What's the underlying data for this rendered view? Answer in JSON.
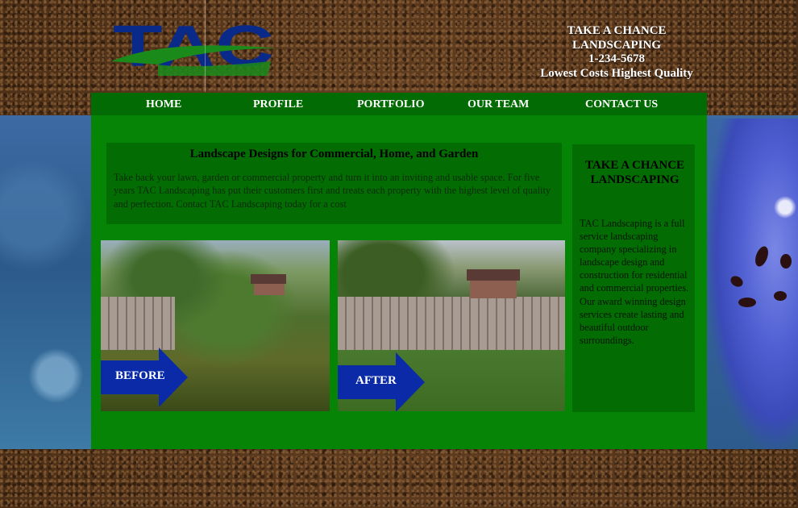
{
  "header": {
    "logo_text": "TAC",
    "company_name": "TAKE A CHANCE LANDSCAPING",
    "phone": "1-234-5678",
    "tagline": "Lowest Costs Highest Quality"
  },
  "nav": {
    "items": [
      "HOME",
      "PROFILE",
      "PORTFOLIO",
      "OUR TEAM",
      "CONTACT US"
    ]
  },
  "intro": {
    "title": "Landscape Designs for Commercial, Home, and Garden",
    "body": "Take back your lawn, garden or commercial property and turn it into an inviting and usable space. For five years TAC Landscaping has put their customers first and treats each property with the highest level of quality and perfection. Contact TAC Landscaping today for a cost"
  },
  "gallery": {
    "before_label": "BEFORE",
    "after_label": "AFTER"
  },
  "sidebar": {
    "title": "TAKE A CHANCE LANDSCAPING",
    "body": "TAC Landscaping is a full service landscaping company specializing in landscape design and construction for residential and commercial properties. Our award winning design services create lasting and beautiful outdoor surroundings."
  },
  "colors": {
    "panel_green": "#058405",
    "nav_green": "#036b03",
    "logo_blue": "#0a2a8a",
    "logo_green": "#1a8a1a",
    "arrow_blue": "#0b2aa8"
  }
}
